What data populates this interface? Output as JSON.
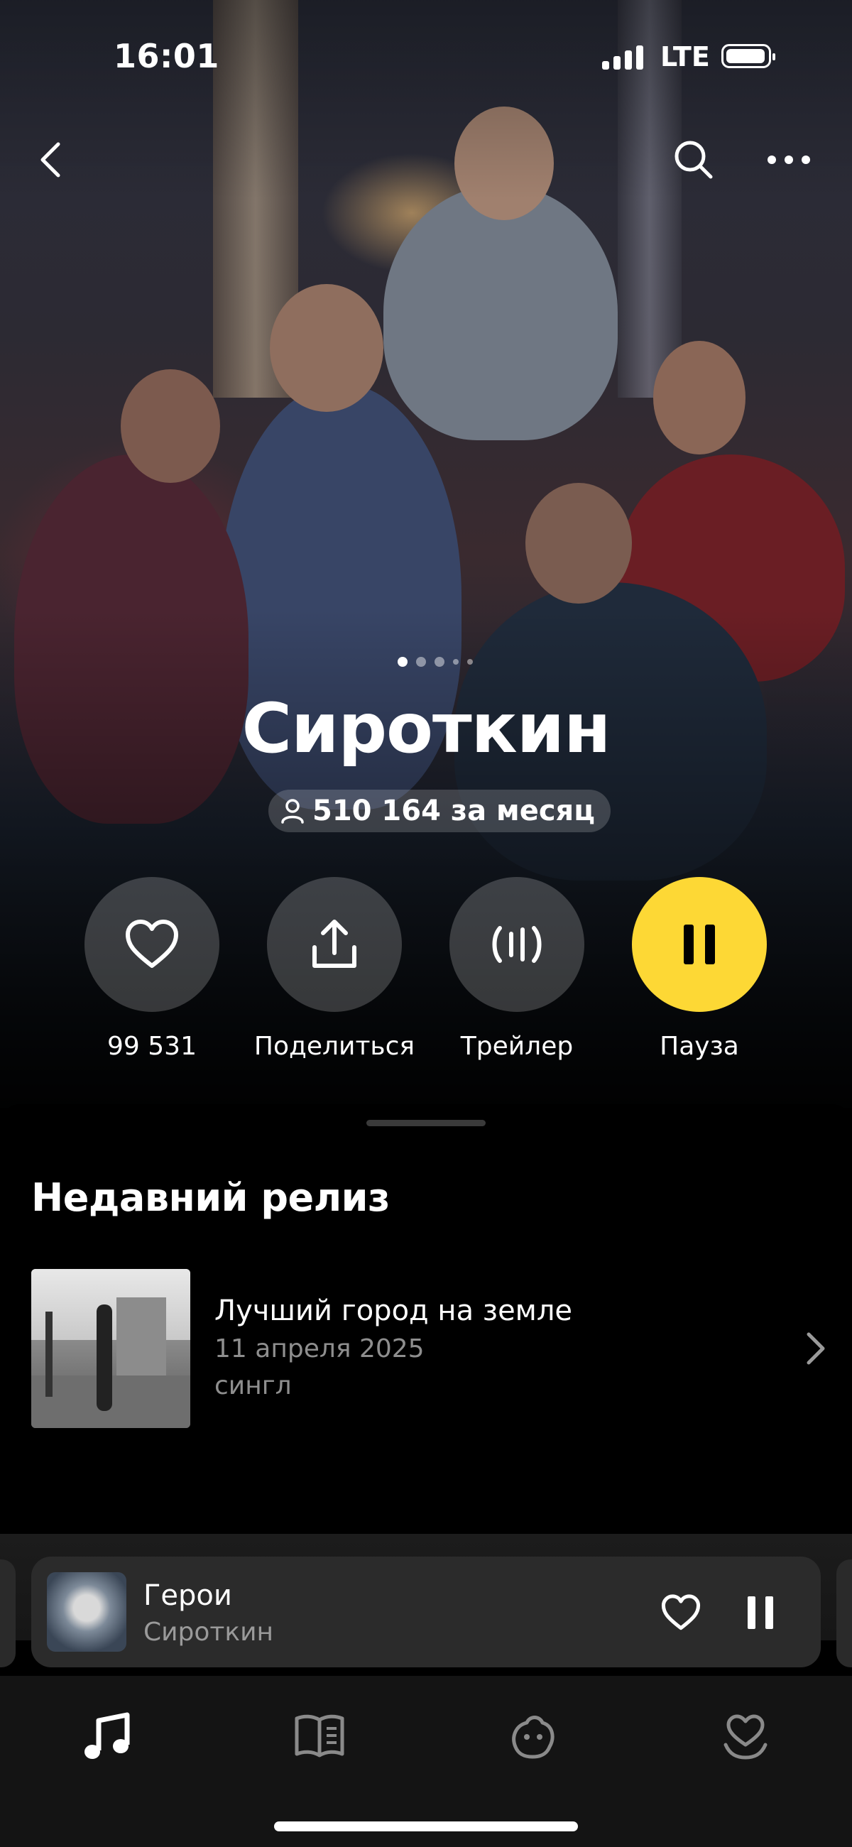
{
  "status_bar": {
    "time": "16:01",
    "network": "LTE"
  },
  "artist": {
    "name": "Сироткин",
    "listeners": "510 164 за месяц",
    "carousel_pages": 5,
    "carousel_active": 1
  },
  "actions": [
    {
      "label": "99 531",
      "icon": "heart-icon"
    },
    {
      "label": "Поделиться",
      "icon": "share-icon"
    },
    {
      "label": "Трейлер",
      "icon": "trailer-wave-icon"
    },
    {
      "label": "Пауза",
      "icon": "pause-icon"
    }
  ],
  "recent": {
    "section_title": "Недавний релиз",
    "title": "Лучший город на земле",
    "date": "11 апреля 2025",
    "type": "сингл"
  },
  "mini_player": {
    "title": "Герои",
    "artist": "Сироткин"
  },
  "tabs": [
    {
      "icon": "music-note-icon",
      "active": true
    },
    {
      "icon": "book-icon",
      "active": false
    },
    {
      "icon": "podcast-creature-icon",
      "active": false
    },
    {
      "icon": "favorites-heart-icon",
      "active": false
    }
  ],
  "colors": {
    "accent_yellow": "#fdd835",
    "background": "#000000",
    "secondary_text": "#8e8e8e"
  }
}
